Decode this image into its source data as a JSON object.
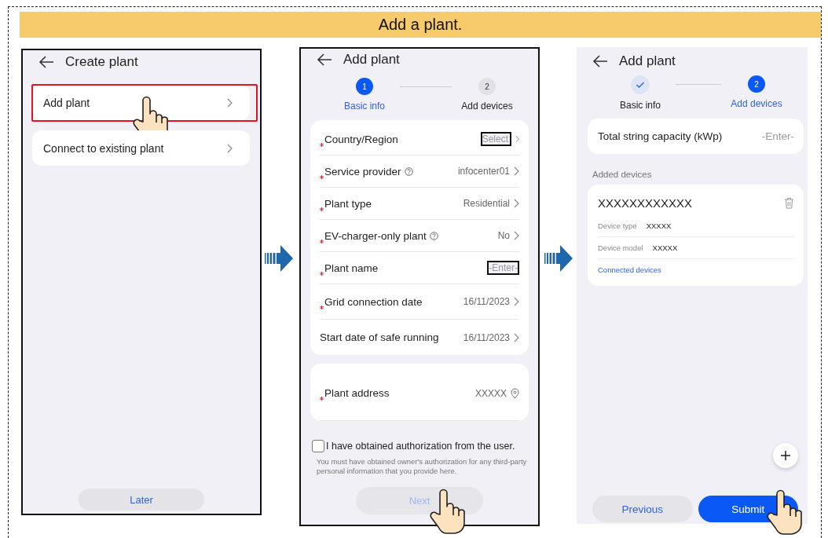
{
  "banner": {
    "title": "Add a plant."
  },
  "screen_create": {
    "title": "Create plant",
    "options": [
      {
        "label": "Add plant",
        "highlighted": true,
        "tapped": true
      },
      {
        "label": "Connect to existing plant",
        "highlighted": false,
        "tapped": false
      }
    ],
    "later_button": "Later"
  },
  "screen_basic_info": {
    "title": "Add plant",
    "steps": [
      {
        "number": "1",
        "label": "Basic info",
        "current": true,
        "done": false
      },
      {
        "number": "2",
        "label": "Add devices",
        "current": false,
        "done": false
      }
    ],
    "fields": [
      {
        "label": "Country/Region",
        "required": true,
        "help": false,
        "placeholder": "Select",
        "chevron": true
      },
      {
        "label": "Service provider",
        "required": true,
        "help": true,
        "value": "infocenter01",
        "chevron": true
      },
      {
        "label": "Plant type",
        "required": true,
        "help": false,
        "value": "Residential",
        "chevron": true
      },
      {
        "label": "EV-charger-only plant",
        "required": true,
        "help": true,
        "value": "No",
        "chevron": true
      },
      {
        "label": "Plant name",
        "required": true,
        "help": false,
        "placeholder": "-Enter-",
        "chevron": false
      },
      {
        "label": "Grid connection date",
        "required": true,
        "help": false,
        "value": "16/11/2023",
        "chevron": true
      },
      {
        "label": "Start date of safe running",
        "required": false,
        "help": false,
        "value": "16/11/2023",
        "chevron": true
      }
    ],
    "address_field": {
      "label": "Plant address",
      "required": true,
      "value": "XXXXX"
    },
    "consent": {
      "label": "I have obtained authorization from the user.",
      "checked": false,
      "note": "You must have obtained owner's authorization for any third-party personal information that you provide here."
    },
    "next_button": {
      "label": "Next",
      "disabled": true,
      "tapped": true
    }
  },
  "screen_add_devices": {
    "title": "Add plant",
    "steps": [
      {
        "label": "Basic info",
        "current": false,
        "done": true
      },
      {
        "number": "2",
        "label": "Add devices",
        "current": true,
        "done": false
      }
    ],
    "capacity": {
      "label": "Total string capacity (kWp)",
      "placeholder": "-Enter-"
    },
    "section_label": "Added devices",
    "device": {
      "name": "XXXXXXXXXXXX",
      "details": [
        {
          "label": "Device type",
          "value": "XXXXX"
        },
        {
          "label": "Device model",
          "value": "XXXXX"
        }
      ],
      "link": "Connected devices"
    },
    "buttons": [
      {
        "label": "Previous",
        "kind": "secondary",
        "tapped": false
      },
      {
        "label": "Submit",
        "kind": "primary",
        "tapped": true
      }
    ]
  }
}
